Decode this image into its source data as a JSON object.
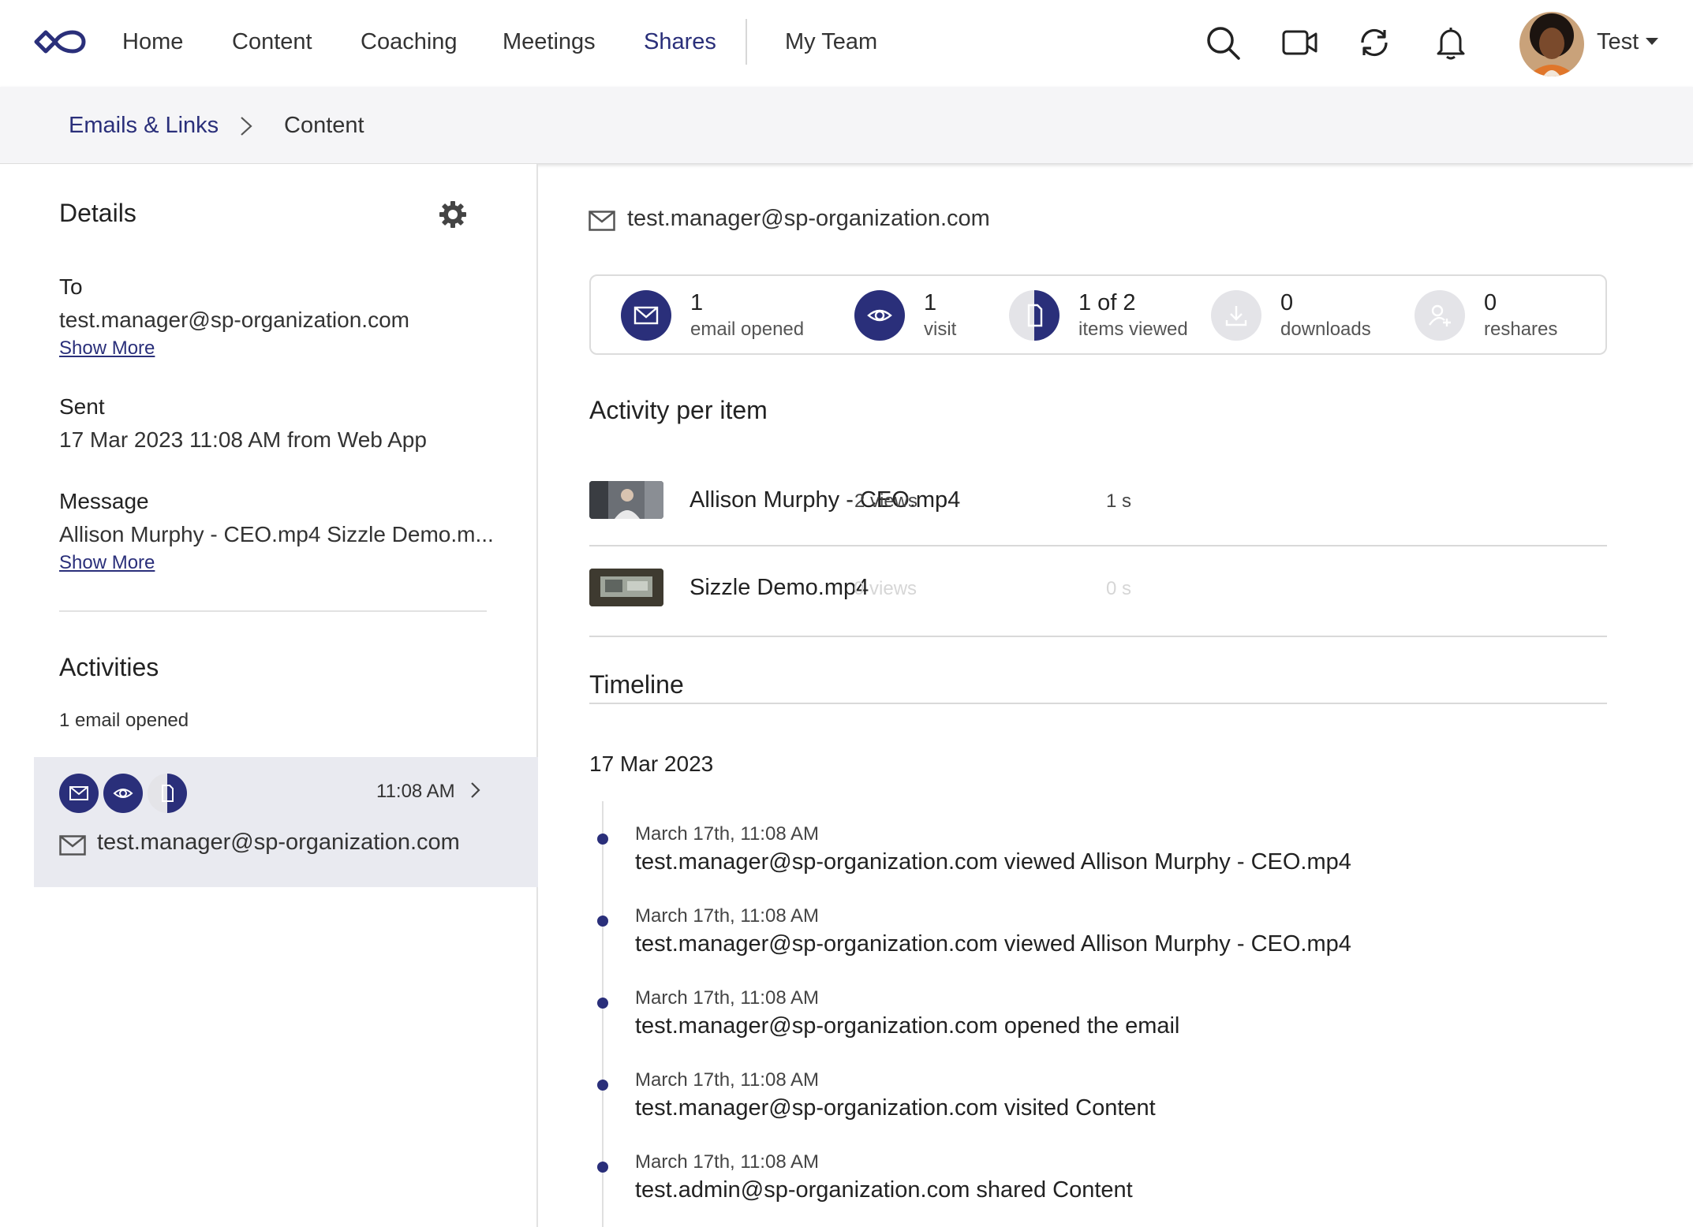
{
  "nav": {
    "items": [
      "Home",
      "Content",
      "Coaching",
      "Meetings",
      "Shares",
      "My Team"
    ],
    "active": "Shares",
    "user_name": "Test"
  },
  "breadcrumb": {
    "link": "Emails & Links",
    "current": "Content"
  },
  "details": {
    "title": "Details",
    "to_label": "To",
    "to_value": "test.manager@sp-organization.com",
    "show_more_1": "Show More",
    "sent_label": "Sent",
    "sent_value": "17 Mar 2023 11:08 AM from Web App",
    "message_label": "Message",
    "message_value": "Allison Murphy - CEO.mp4 Sizzle Demo.m...",
    "show_more_2": "Show More"
  },
  "activities": {
    "title": "Activities",
    "summary": "1 email opened",
    "card": {
      "time": "11:08 AM",
      "email": "test.manager@sp-organization.com"
    }
  },
  "main": {
    "recipient": "test.manager@sp-organization.com",
    "stats": [
      {
        "num": "1",
        "label": "email opened",
        "icon": "mail-icon"
      },
      {
        "num": "1",
        "label": "visit",
        "icon": "eye-icon"
      },
      {
        "num": "1 of 2",
        "label": "items viewed",
        "icon": "document-icon"
      },
      {
        "num": "0",
        "label": "downloads",
        "icon": "download-icon"
      },
      {
        "num": "0",
        "label": "reshares",
        "icon": "add-user-icon"
      }
    ],
    "activity_title": "Activity per item",
    "items": [
      {
        "name": "Allison Murphy - CEO.mp4",
        "views": "2 views",
        "time": "1 s"
      },
      {
        "name": "Sizzle Demo.mp4",
        "views": "0 views",
        "time": "0 s"
      }
    ],
    "timeline_title": "Timeline",
    "timeline_date": "17 Mar 2023",
    "timeline": [
      {
        "time": "March 17th, 11:08 AM",
        "text": "test.manager@sp-organization.com viewed Allison Murphy - CEO.mp4"
      },
      {
        "time": "March 17th, 11:08 AM",
        "text": "test.manager@sp-organization.com viewed Allison Murphy - CEO.mp4"
      },
      {
        "time": "March 17th, 11:08 AM",
        "text": "test.manager@sp-organization.com opened the email"
      },
      {
        "time": "March 17th, 11:08 AM",
        "text": "test.manager@sp-organization.com visited Content"
      },
      {
        "time": "March 17th, 11:08 AM",
        "text": "test.admin@sp-organization.com shared Content"
      }
    ]
  },
  "colors": {
    "brand": "#2a2f7a",
    "active_card": "#e9eaf0",
    "muted": "#d6d6d6"
  }
}
